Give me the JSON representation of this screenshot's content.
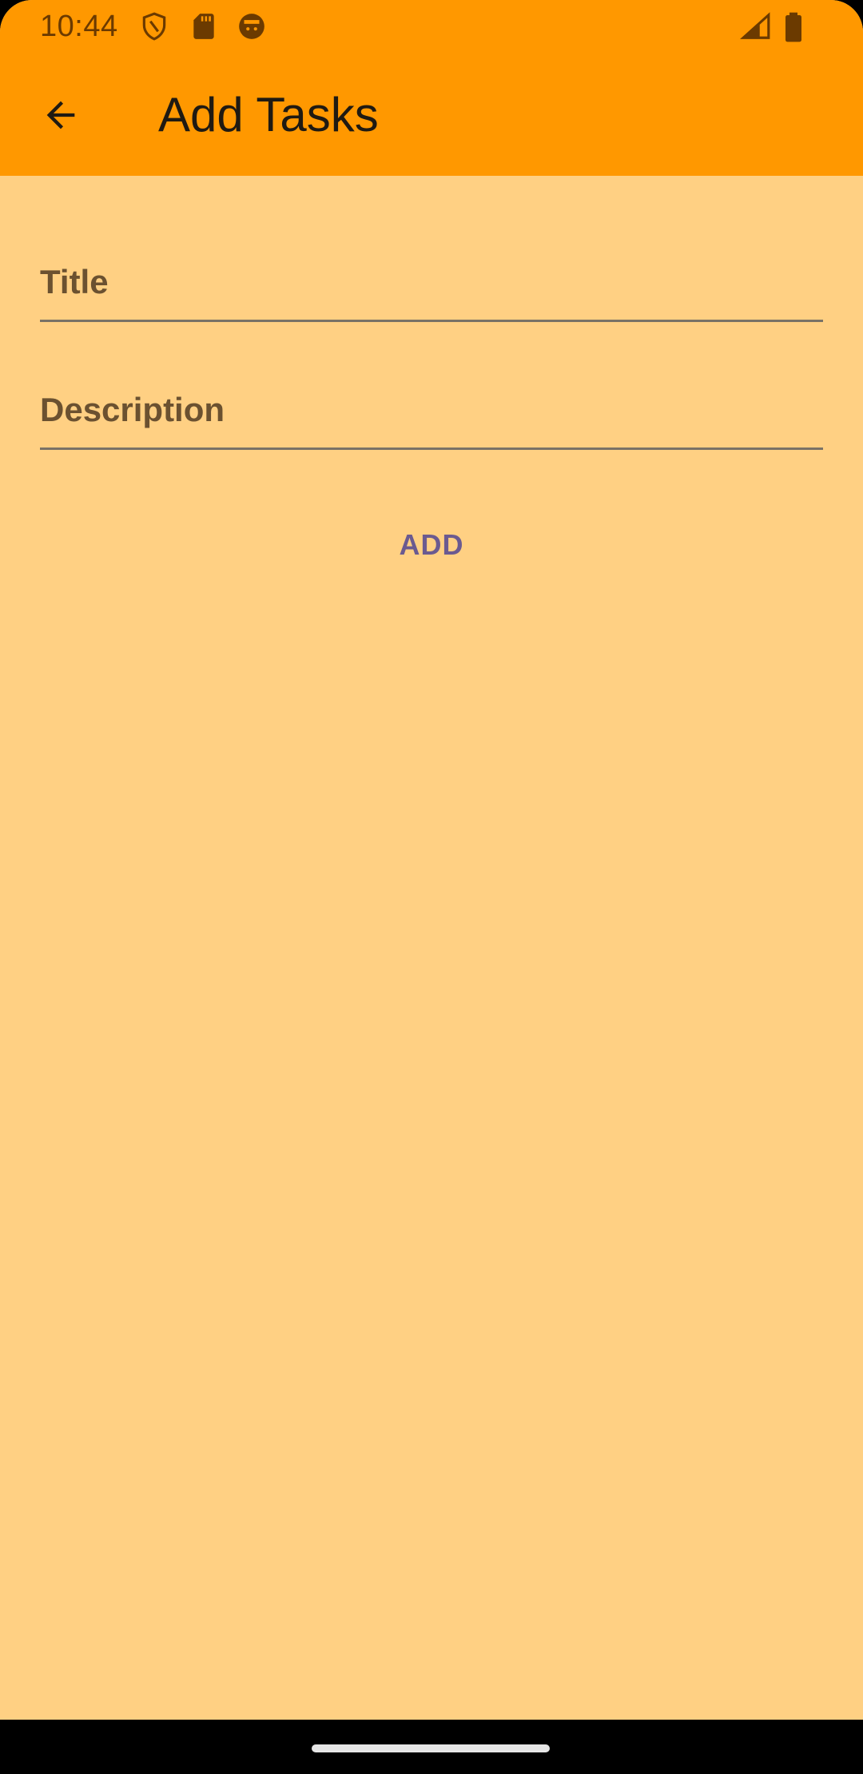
{
  "status_bar": {
    "time": "10:44",
    "icons": [
      "shield-icon",
      "sd-card-icon",
      "face-icon",
      "signal-icon",
      "battery-icon"
    ],
    "icon_color": "#6B3A00"
  },
  "app_bar": {
    "title": "Add Tasks",
    "background": "#FF9800"
  },
  "form": {
    "title_field": {
      "value": "",
      "placeholder": "Title"
    },
    "description_field": {
      "value": "",
      "placeholder": "Description"
    },
    "add_label": "ADD"
  },
  "colors": {
    "page_background": "#FFD083",
    "accent_text": "#6B5A90"
  }
}
